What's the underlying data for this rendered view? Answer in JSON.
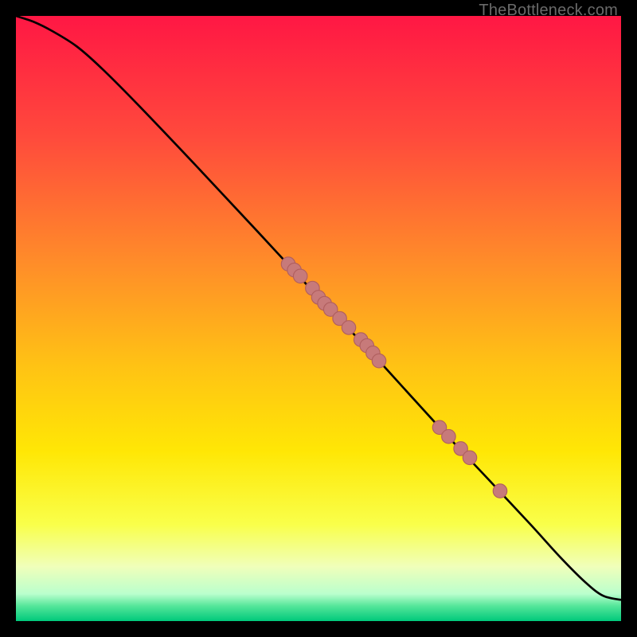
{
  "watermark": "TheBottleneck.com",
  "colors": {
    "curve": "#000000",
    "dot_fill": "#c77a7a",
    "dot_stroke": "#b05f5f",
    "gradient_stops": [
      {
        "offset": 0.0,
        "color": "#ff1744"
      },
      {
        "offset": 0.2,
        "color": "#ff4a3c"
      },
      {
        "offset": 0.4,
        "color": "#ff8a2a"
      },
      {
        "offset": 0.58,
        "color": "#ffc314"
      },
      {
        "offset": 0.72,
        "color": "#ffe705"
      },
      {
        "offset": 0.84,
        "color": "#f9ff4a"
      },
      {
        "offset": 0.91,
        "color": "#f0ffba"
      },
      {
        "offset": 0.955,
        "color": "#baffcd"
      },
      {
        "offset": 0.975,
        "color": "#55e69a"
      },
      {
        "offset": 1.0,
        "color": "#00c97b"
      }
    ]
  },
  "chart_data": {
    "type": "line",
    "title": "",
    "xlabel": "",
    "ylabel": "",
    "xlim": [
      0,
      100
    ],
    "ylim": [
      0,
      100
    ],
    "curve": {
      "x": [
        0,
        3,
        6,
        10,
        14,
        20,
        30,
        40,
        50,
        55,
        60,
        70,
        78,
        85,
        90,
        94,
        97,
        100
      ],
      "y": [
        100,
        99,
        97.5,
        95,
        91.5,
        85.5,
        75,
        64.3,
        53.5,
        48.3,
        43,
        32,
        23.5,
        16,
        10.5,
        6.5,
        4.2,
        3.5
      ]
    },
    "scatter": {
      "x": [
        45,
        46,
        47,
        49,
        50,
        51,
        52,
        53.5,
        55,
        57,
        58,
        59,
        60,
        70,
        71.5,
        73.5,
        75,
        80
      ],
      "y": [
        59,
        58,
        57,
        55,
        53.5,
        52.5,
        51.5,
        50,
        48.5,
        46.5,
        45.5,
        44.3,
        43,
        32,
        30.5,
        28.5,
        27,
        21.5
      ]
    }
  }
}
